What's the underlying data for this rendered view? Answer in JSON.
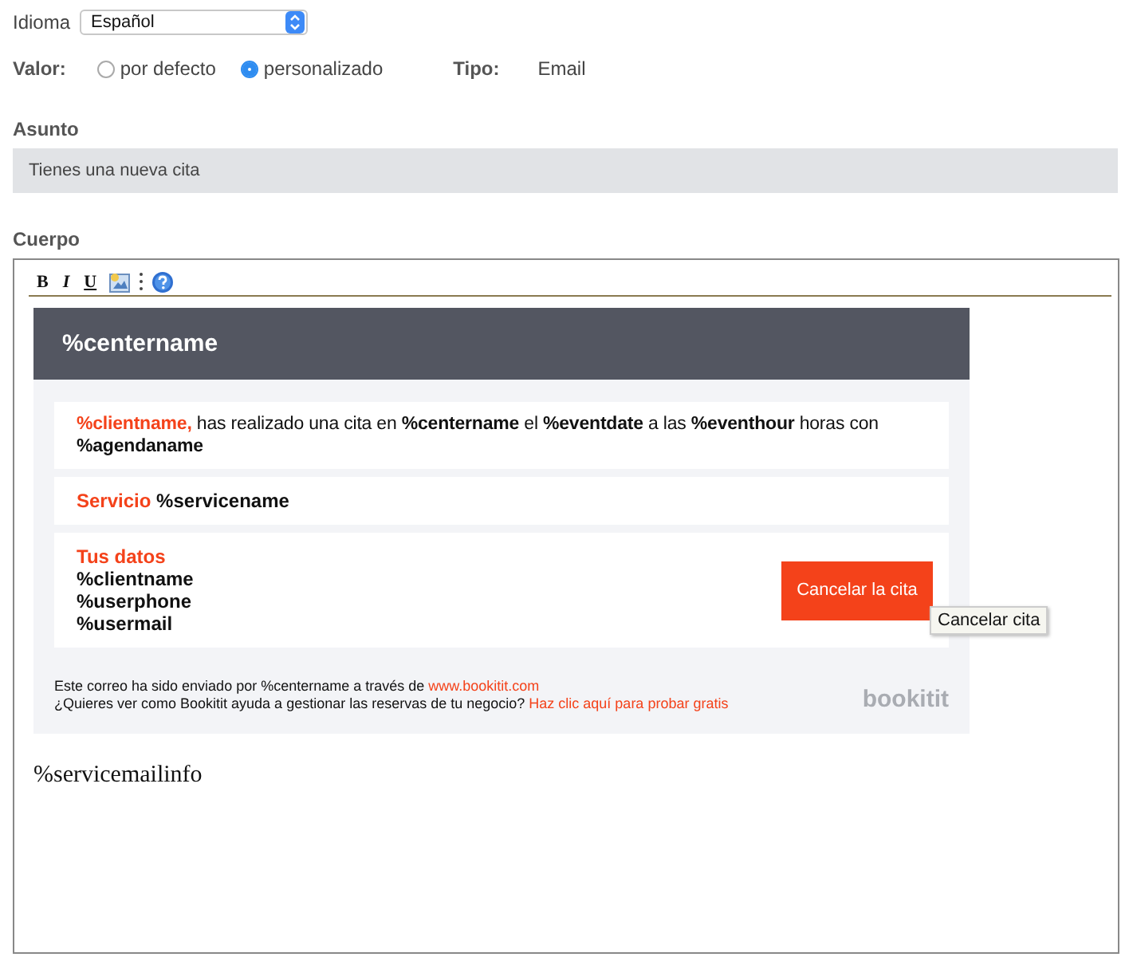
{
  "language": {
    "label": "Idioma",
    "value": "Español"
  },
  "value": {
    "label": "Valor:",
    "options": [
      {
        "label": "por defecto",
        "selected": false
      },
      {
        "label": "personalizado",
        "selected": true
      }
    ]
  },
  "type": {
    "label": "Tipo:",
    "value": "Email"
  },
  "subject": {
    "label": "Asunto",
    "value": "Tienes una nueva cita"
  },
  "body": {
    "label": "Cuerpo",
    "toolbar": [
      {
        "kind": "bold",
        "label": "B"
      },
      {
        "kind": "italic",
        "label": "I"
      },
      {
        "kind": "underline",
        "label": "U"
      },
      {
        "kind": "image"
      },
      {
        "kind": "separator"
      },
      {
        "kind": "help"
      }
    ],
    "email": {
      "header": "%centername",
      "message": [
        {
          "kind": "accent",
          "text": "%clientname,"
        },
        {
          "kind": "plain",
          "text": " has realizado una cita en "
        },
        {
          "kind": "bold",
          "text": "%centername"
        },
        {
          "kind": "plain",
          "text": " el "
        },
        {
          "kind": "bold",
          "text": "%eventdate"
        },
        {
          "kind": "plain",
          "text": " a las "
        },
        {
          "kind": "bold",
          "text": "%eventhour"
        },
        {
          "kind": "plain",
          "text": " horas con "
        },
        {
          "kind": "bold",
          "text": "%agendaname"
        }
      ],
      "service": {
        "label": "Servicio",
        "value": "%servicename"
      },
      "details": {
        "title": "Tus datos",
        "lines": [
          "%clientname",
          "%userphone",
          "%usermail"
        ],
        "button": "Cancelar la cita",
        "tooltip": "Cancelar cita"
      },
      "footer": [
        {
          "text": "Este correo ha sido enviado por %centername a través de",
          "link": "www.bookitit.com"
        },
        {
          "text": "¿Quieres ver como Bookitit ayuda a gestionar las reservas de tu negocio?",
          "link": "Haz clic aquí para probar gratis"
        }
      ],
      "logo": "bookitit"
    },
    "after": "%servicemailinfo"
  }
}
